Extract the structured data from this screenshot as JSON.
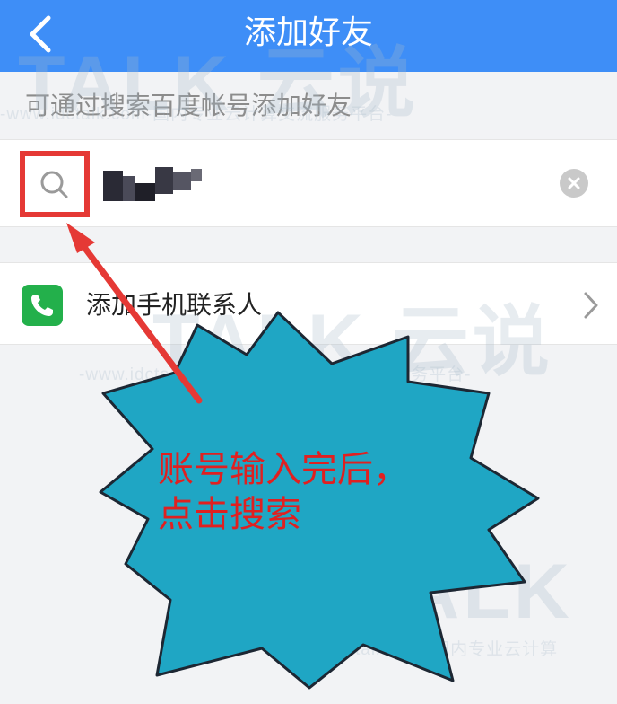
{
  "header": {
    "title": "添加好友"
  },
  "hint": "可通过搜索百度帐号添加好友",
  "search": {
    "value": "",
    "placeholder": ""
  },
  "contacts": {
    "label": "添加手机联系人"
  },
  "callout": {
    "line1": "账号输入完后，",
    "line2": "点击搜索"
  },
  "watermark": {
    "brand": "TALK 云说",
    "brand2": "TALK",
    "site": "-www.idctalk.com-国内专业云计算交流服务平台-",
    "site2": "-www.idctalk.com-国内专业云计算"
  },
  "colors": {
    "header": "#3e8ef7",
    "highlight": "#e53935",
    "callout_fill": "#1fa6c4",
    "phone": "#23b04b"
  },
  "icons": {
    "back": "chevron-left-icon",
    "search": "search-icon",
    "clear": "clear-icon",
    "phone": "phone-icon",
    "chevron": "chevron-right-icon"
  }
}
